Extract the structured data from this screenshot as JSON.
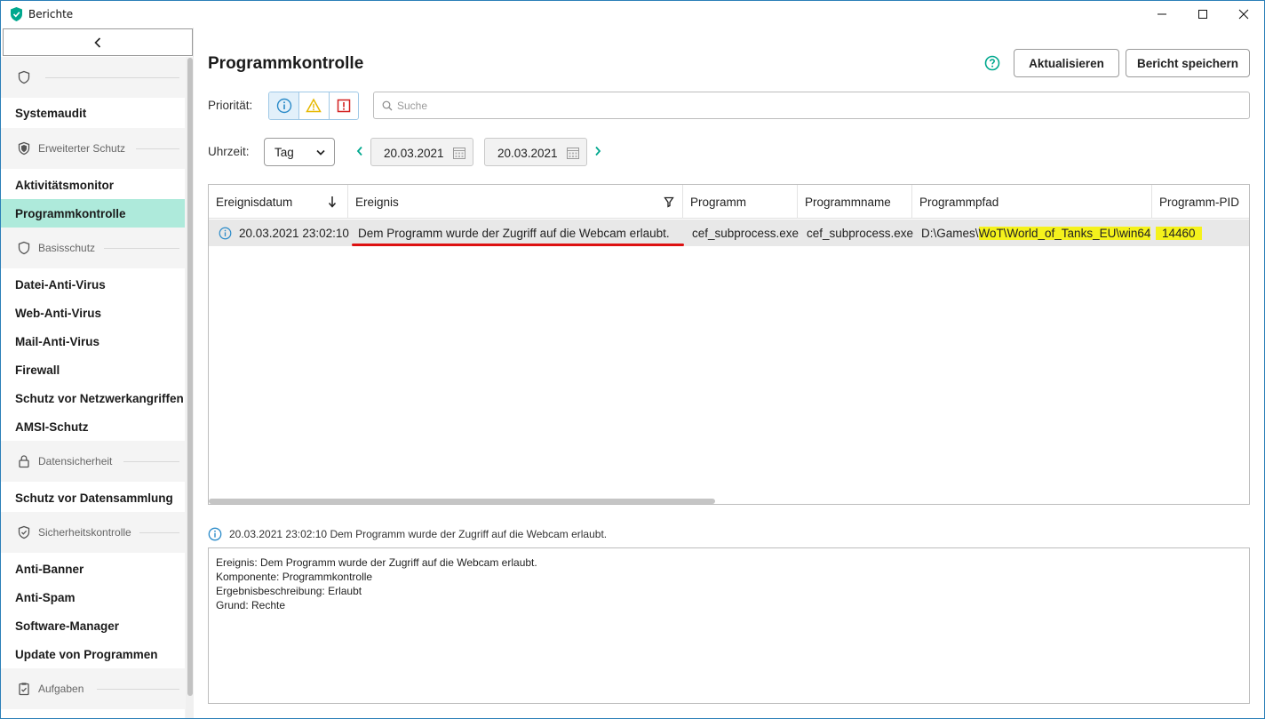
{
  "window": {
    "title": "Berichte"
  },
  "sidebar": {
    "groups": [
      {
        "header": "",
        "icon": "shield-icon",
        "items": [
          "Systemaudit"
        ]
      },
      {
        "header": "Erweiterter Schutz",
        "icon": "shield-plus-icon",
        "items": [
          "Aktivitätsmonitor",
          "Programmkontrolle"
        ]
      },
      {
        "header": "Basisschutz",
        "icon": "shield-outline-icon",
        "items": [
          "Datei-Anti-Virus",
          "Web-Anti-Virus",
          "Mail-Anti-Virus",
          "Firewall",
          "Schutz vor Netzwerkangriffen",
          "AMSI-Schutz"
        ]
      },
      {
        "header": "Datensicherheit",
        "icon": "lock-icon",
        "items": [
          "Schutz vor Datensammlung"
        ]
      },
      {
        "header": "Sicherheitskontrolle",
        "icon": "shield-check-icon",
        "items": [
          "Anti-Banner",
          "Anti-Spam",
          "Software-Manager",
          "Update von Programmen"
        ]
      },
      {
        "header": "Aufgaben",
        "icon": "clipboard-check-icon",
        "items": []
      }
    ],
    "active_item": "Programmkontrolle"
  },
  "main": {
    "title": "Programmkontrolle",
    "buttons": {
      "refresh": "Aktualisieren",
      "save_report": "Bericht speichern"
    },
    "priority": {
      "label": "Priorität:",
      "levels": [
        "info",
        "warning",
        "critical"
      ],
      "selected": "info"
    },
    "search": {
      "placeholder": "Suche",
      "value": ""
    },
    "time": {
      "label": "Uhrzeit:",
      "period": "Tag",
      "from": "20.03.2021",
      "to": "20.03.2021"
    },
    "table": {
      "columns": [
        "Ereignisdatum",
        "Ereignis",
        "Programm",
        "Programmname",
        "Programmpfad",
        "Programm-PID"
      ],
      "sorted_column": "Ereignisdatum",
      "filtered_column": "Ereignis",
      "rows": [
        {
          "level": "info",
          "date": "20.03.2021 23:02:10",
          "event": "Dem Programm wurde der Zugriff auf die Webcam erlaubt.",
          "program": "cef_subprocess.exe",
          "program_name": "cef_subprocess.exe",
          "path_prefix": "D:\\Games\\",
          "path_highlight": "WoT\\World_of_Tanks_EU\\win64",
          "pid": "14460"
        }
      ]
    },
    "detail": {
      "summary": "20.03.2021 23:02:10 Dem Programm wurde der Zugriff auf die Webcam erlaubt.",
      "lines": [
        "Ereignis: Dem Programm wurde der Zugriff auf die Webcam erlaubt.",
        "Komponente: Programmkontrolle",
        "Ergebnisbeschreibung: Erlaubt",
        "Grund: Rechte"
      ]
    }
  },
  "colors": {
    "accent": "#00a88e",
    "active_bg": "#aeeadb",
    "highlight": "#f5f21c",
    "underline": "#dd1111",
    "info": "#2b8bc9",
    "warning": "#e6b800",
    "critical": "#d32020"
  }
}
